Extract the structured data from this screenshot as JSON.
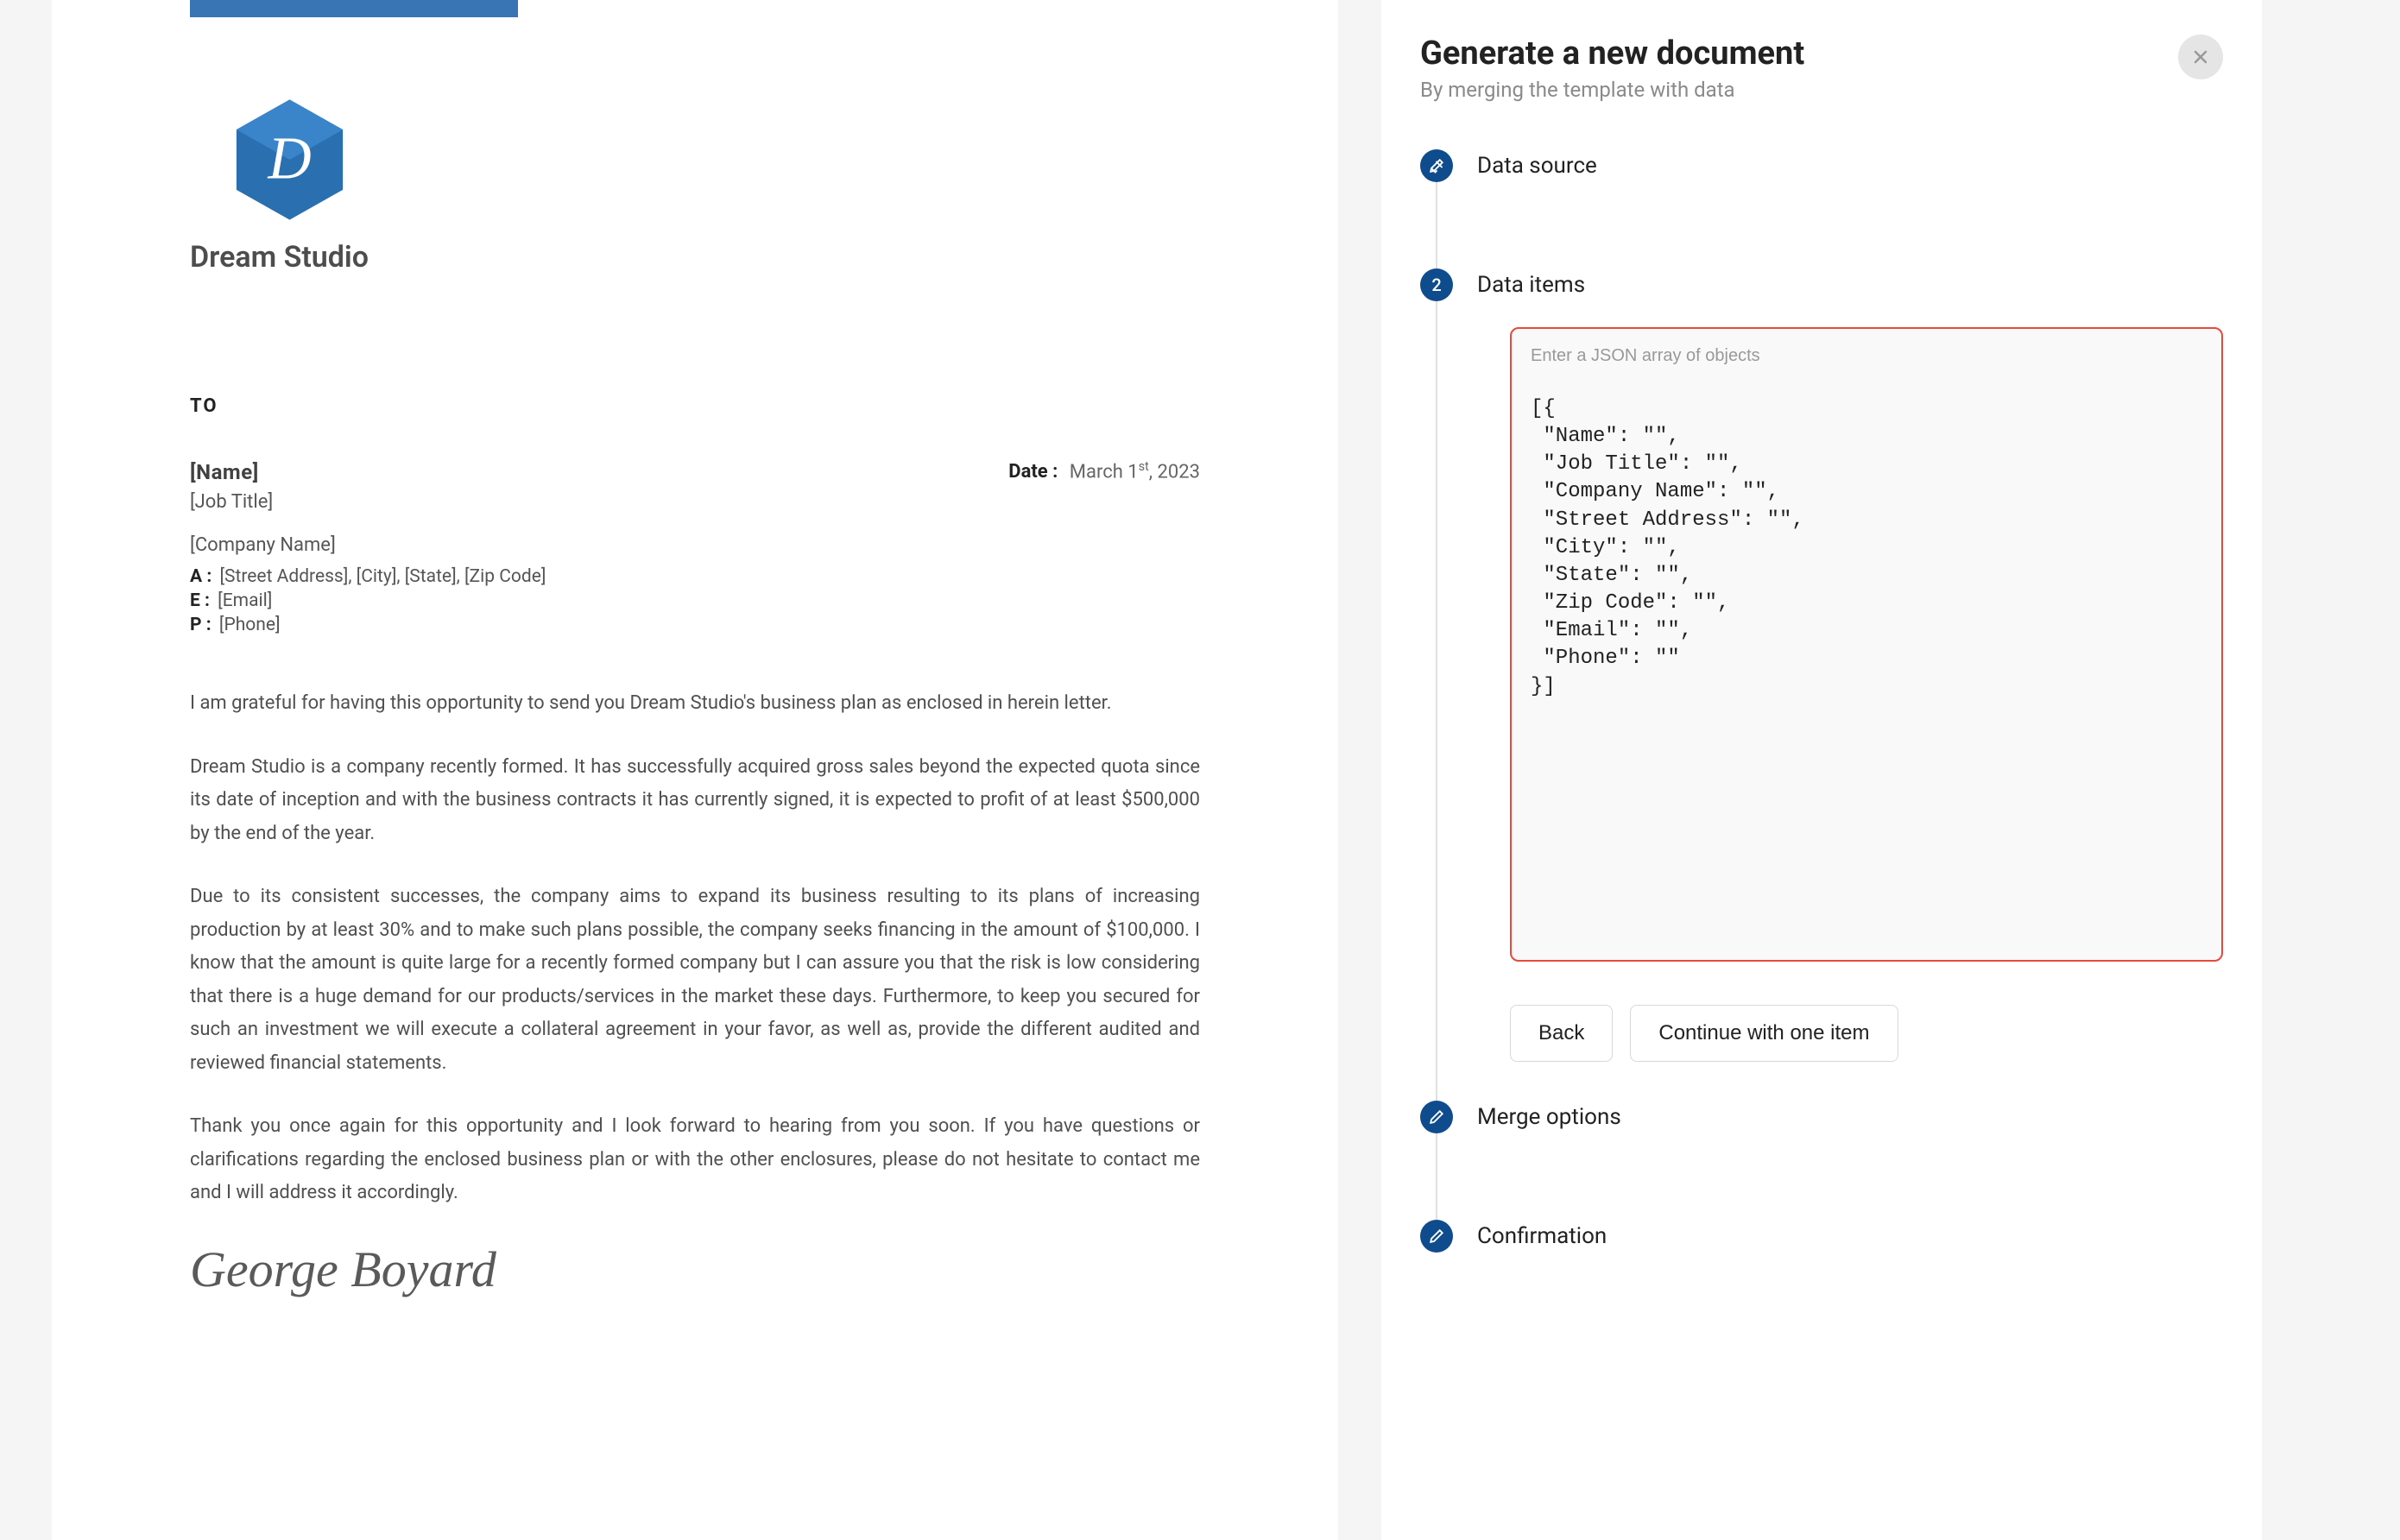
{
  "document": {
    "company_name": "Dream Studio",
    "to_label": "TO",
    "recipient_name": "[Name]",
    "job_title": "[Job Title]",
    "company_line": "[Company Name]",
    "date_label": "Date :",
    "date_month": "March 1",
    "date_ordinal": "st",
    "date_year": ", 2023",
    "address_label": "A :",
    "address_value": "[Street Address], [City], [State], [Zip Code]",
    "email_label": "E :",
    "email_value": "[Email]",
    "phone_label": "P :",
    "phone_value": "[Phone]",
    "para1": "I am grateful for having this opportunity to send you Dream Studio's business plan as enclosed in herein letter.",
    "para2": "Dream Studio is a company recently formed. It has successfully acquired gross sales beyond the expected quota since its date of inception and with the business contracts it has currently signed, it is expected to profit of at least $500,000 by the end of the year.",
    "para3": "Due to its consistent successes, the company aims to expand its business resulting to its plans of increasing production by at least 30% and to make such plans possible, the company seeks financing in the amount of $100,000. I know that the amount is quite large for a recently formed company but I can assure you that the risk is low considering that there is a huge demand for our products/services in the market these days. Furthermore, to keep you secured for such an investment we will execute a collateral agreement in your favor, as well as, provide the different audited and reviewed financial statements.",
    "para4": "Thank you once again for this opportunity and I look forward to hearing from you soon. If you have questions or clarifications regarding the enclosed business plan or with the other enclosures, please do not hesitate to contact me and I will address it accordingly.",
    "signature": "George Boyard"
  },
  "panel": {
    "title": "Generate a new document",
    "subtitle": "By merging the template with data",
    "step1_label": "Data source",
    "step2_label": "Data items",
    "step2_number": "2",
    "step3_label": "Merge options",
    "step4_label": "Confirmation",
    "textarea_hint": "Enter a JSON array of objects",
    "json_content": "[{\n \"Name\": \"\",\n \"Job Title\": \"\",\n \"Company Name\": \"\",\n \"Street Address\": \"\",\n \"City\": \"\",\n \"State\": \"\",\n \"Zip Code\": \"\",\n \"Email\": \"\",\n \"Phone\": \"\"\n}]",
    "back_button": "Back",
    "continue_button": "Continue with one item"
  }
}
